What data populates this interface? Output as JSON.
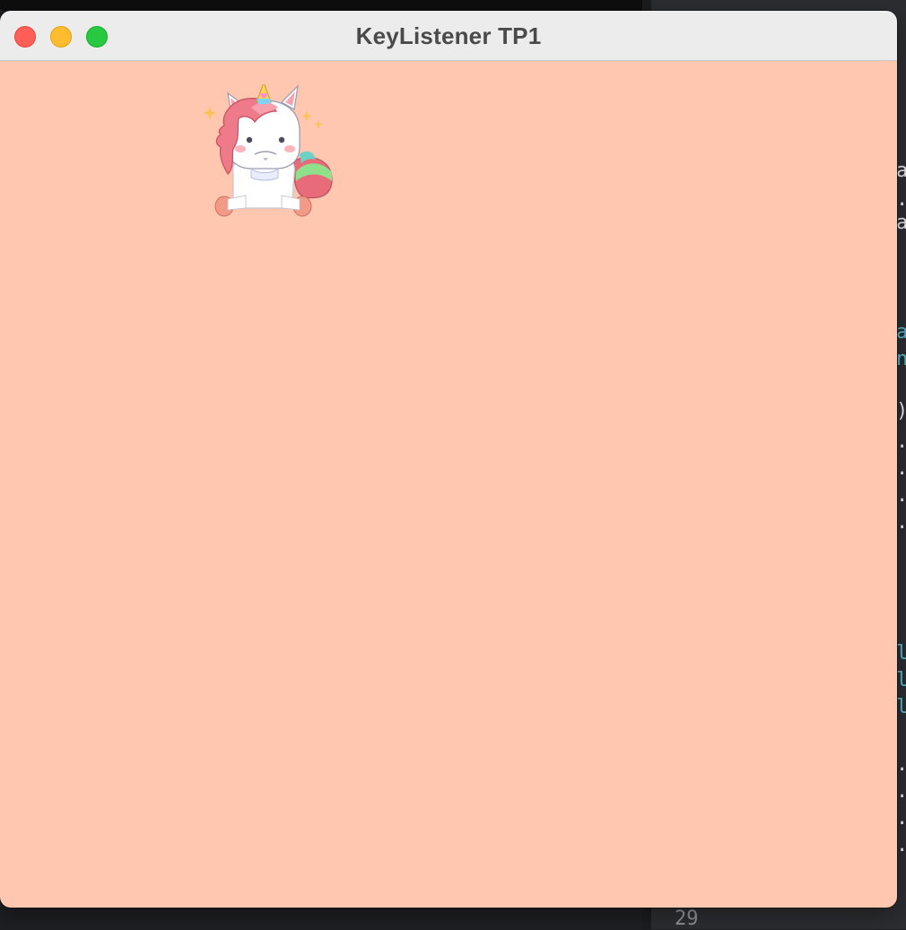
{
  "window": {
    "title": "KeyListener TP1",
    "background_color": "#ffc6b0",
    "traffic_lights": {
      "close": "#ff5f57",
      "minimize": "#febc2e",
      "zoom": "#28c840"
    }
  },
  "canvas": {
    "sprite": "unicorn-sprite"
  },
  "background_editor": {
    "line_number": "29",
    "glyphs": [
      "a",
      ".",
      "a",
      "a",
      "n",
      ")",
      ".",
      ".",
      ".",
      ".",
      "l",
      "l",
      "l",
      ".",
      ".",
      ".",
      "."
    ]
  }
}
